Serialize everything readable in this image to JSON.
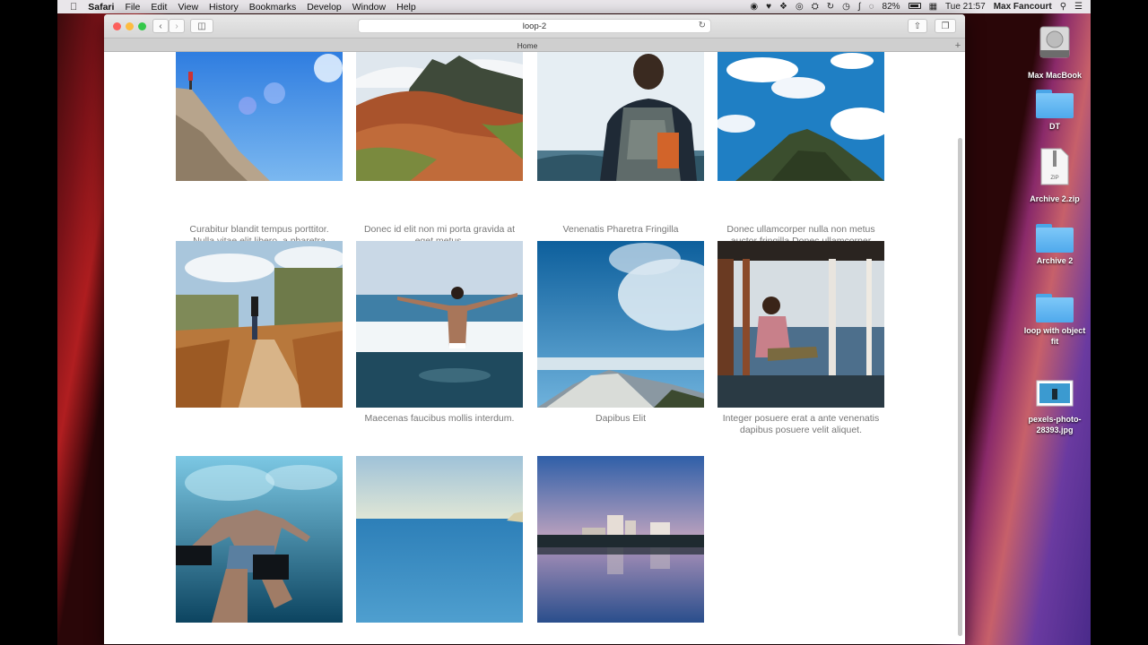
{
  "menubar": {
    "app_name": "Safari",
    "menus": [
      "File",
      "Edit",
      "View",
      "History",
      "Bookmarks",
      "Develop",
      "Window",
      "Help"
    ],
    "battery": "82%",
    "clock": "Tue 21:57",
    "user": "Max Fancourt"
  },
  "browser": {
    "url": "loop-2",
    "tab_title": "Home"
  },
  "gallery": [
    {
      "caption": "Curabitur blandit tempus porttitor. Nulla vitae elit libero, a pharetra augue."
    },
    {
      "caption": "Donec id elit non mi porta gravida at eget metus."
    },
    {
      "caption": "Venenatis Pharetra Fringilla"
    },
    {
      "caption": "Donec ullamcorper nulla non metus auctor fringilla.Donec ullamcorper nulla non metus auctor fringilla."
    },
    {
      "caption": ""
    },
    {
      "caption": "Maecenas faucibus mollis interdum."
    },
    {
      "caption": "Dapibus Elit"
    },
    {
      "caption": "Integer posuere erat a ante venenatis dapibus posuere velit aliquet."
    },
    {
      "caption": ""
    },
    {
      "caption": ""
    },
    {
      "caption": ""
    }
  ],
  "desktop": {
    "icons": [
      {
        "label": "Max MacBook"
      },
      {
        "label": "DT"
      },
      {
        "label": "Archive 2.zip"
      },
      {
        "label": "Archive 2"
      },
      {
        "label": "loop with object fit"
      },
      {
        "label": "pexels-photo-28393.jpg"
      }
    ]
  }
}
